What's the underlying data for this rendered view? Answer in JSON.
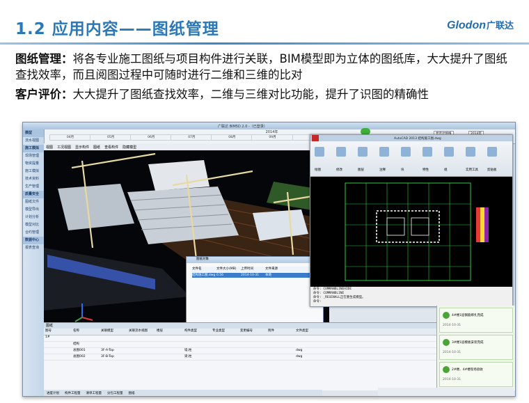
{
  "slide": {
    "title": "1.2 应用内容——图纸管理",
    "logo_latin": "Glodon",
    "logo_cn": "广联达",
    "p1_label": "图纸管理：",
    "p1_text": "将各专业施工图纸与项目构件进行关联，BIM模型即为立体的图纸库，大大提升了图纸查找效率，而且阅图过程中可随时进行二维和三维的比对",
    "p2_label": "客户评价：",
    "p2_text": "大大提升了图纸查找效率，二维与三维对比功能，提升了识图的精确性"
  },
  "screenshot": {
    "app_title": "广联达 BIM5D 2.0 -（已登录）",
    "year_label": "2014年",
    "months": [
      "04月",
      "05月",
      "06月",
      "07月",
      "08月",
      "09月",
      "10月",
      "11月",
      "12月",
      "01月",
      "02月"
    ],
    "gantt_buttons": [
      "显示计划线",
      "2014年"
    ],
    "left_nav": [
      {
        "label": "模型",
        "header": true
      },
      {
        "label": "流水视图",
        "header": false
      },
      {
        "label": "施工模拟",
        "header": true
      },
      {
        "label": "现场管理",
        "header": false
      },
      {
        "label": "物资提量",
        "header": false
      },
      {
        "label": "施工模拟",
        "header": false
      },
      {
        "label": "技术资料",
        "header": false
      },
      {
        "label": "生产管理",
        "header": false
      },
      {
        "label": "质量安全",
        "header": true
      },
      {
        "label": "图纸文件",
        "header": false
      },
      {
        "label": "模型导出",
        "header": false
      },
      {
        "label": "计划分析",
        "header": false
      },
      {
        "label": "模型对比",
        "header": false
      },
      {
        "label": "合约管理",
        "header": false
      },
      {
        "label": "数据中心",
        "header": true
      },
      {
        "label": "报表查询",
        "header": false
      }
    ],
    "viewport_toolbar": [
      "视图",
      "工况视图",
      "显示构件",
      "图纸",
      "查看构件",
      "隐藏模型"
    ],
    "popup": {
      "title": "图纸对象",
      "columns": [
        "文件名",
        "文件大小(MB)",
        "上传时间",
        "文件来源"
      ],
      "selected_row": [
        "结构施工图.dwg",
        "0.56",
        "2014-10-31",
        "本地"
      ]
    },
    "cad": {
      "title": "AutoCAD 2013   结构施工图.dwg",
      "ribbon_groups": [
        "绘图",
        "修改",
        "图层",
        "注释",
        "块",
        "特性",
        "组",
        "实用工具",
        "剪贴板"
      ],
      "command_lines": [
        "命令: COMMANDLINEHIDE",
        "命令: COMMANDLINE",
        "命令: _REGENALL正在重生成模型。",
        "命令:"
      ]
    },
    "bottom_panel": {
      "title": "图纸",
      "columns": [
        "图号",
        "名称",
        "关联模型",
        "关联流水视图",
        "楼层",
        "构件类型",
        "专业类型",
        "变更编号",
        "附件",
        "文件类型"
      ],
      "rows": [
        [
          "1#",
          "",
          "",
          "",
          "",
          "",
          "",
          "",
          "",
          ""
        ],
        [
          "",
          "结构",
          "",
          "",
          "",
          "",
          "",
          "",
          "",
          ""
        ],
        [
          "",
          "总图001",
          "3F-A-Top",
          "",
          "",
          "墙,柱",
          "",
          "",
          "",
          "dwg"
        ],
        [
          "",
          "总图002",
          "3F-B-Top",
          "",
          "",
          "梁,柱",
          "",
          "",
          "",
          "dwg"
        ]
      ]
    },
    "bottom_tabs": [
      "进度计划",
      "构件工程量",
      "清单工程量",
      "分包工程量",
      "图纸"
    ],
    "notifications": [
      {
        "text": "4#楼1层钢筋绑扎完成",
        "date": "2014-10-31"
      },
      {
        "text": "3#楼1层模板安装完成",
        "date": "2014-10-31"
      },
      {
        "text": "2#楼、4#楼现场验收",
        "date": "2014-10-31"
      }
    ]
  },
  "colors": {
    "title_blue": "#2a78b8",
    "logo_blue": "#1f6db4",
    "gantt_marker": "#3fae3a",
    "cad_bg": "#000000",
    "viewport_bg": "#04060a"
  }
}
